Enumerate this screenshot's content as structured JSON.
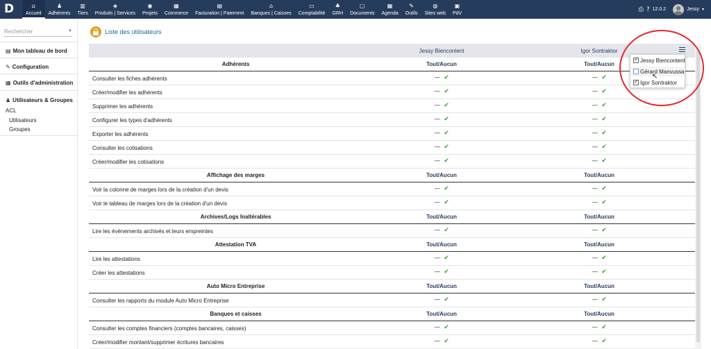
{
  "topbar": {
    "logo": "D",
    "menu": [
      {
        "icon": "⌂",
        "label": "Accueil",
        "active": true
      },
      {
        "icon": "♟",
        "label": "Adhérents"
      },
      {
        "icon": "▥",
        "label": "Tiers"
      },
      {
        "icon": "◈",
        "label": "Produits | Services"
      },
      {
        "icon": "◉",
        "label": "Projets"
      },
      {
        "icon": "▦",
        "label": "Commerce"
      },
      {
        "icon": "▤",
        "label": "Facturation | Paiement"
      },
      {
        "icon": "⌂",
        "label": "Banques | Caisses"
      },
      {
        "icon": "▭",
        "label": "Comptabilité"
      },
      {
        "icon": "♣",
        "label": "GRH"
      },
      {
        "icon": "▢",
        "label": "Documents"
      },
      {
        "icon": "▦",
        "label": "Agenda"
      },
      {
        "icon": "✎",
        "label": "Outils"
      },
      {
        "icon": "◍",
        "label": "Sites web"
      },
      {
        "icon": "▣",
        "label": "PdV"
      }
    ],
    "version": "12.0.2",
    "user": "Jessy",
    "print_icon": "⎙",
    "help_icon": "?"
  },
  "sidebar": {
    "search_placeholder": "Rechercher",
    "sections": [
      {
        "icon": "▤",
        "title": "Mon tableau de bord"
      },
      {
        "icon": "✎",
        "title": "Configuration"
      },
      {
        "icon": "▦",
        "title": "Outils d'administration"
      },
      {
        "icon": "♟",
        "title": "Utilisateurs & Groupes",
        "items": [
          "ACL",
          "Utilisateurs",
          "Groupes"
        ]
      }
    ]
  },
  "page": {
    "title": "Liste des utilisateurs"
  },
  "columns": [
    "Jessy Biencontent",
    "Igor Sontraktor"
  ],
  "toggle_label": "Tout/Aucun",
  "marks": {
    "dash": "—",
    "check": "✔"
  },
  "sections": [
    {
      "title": "Adhérents",
      "perms": [
        "Consulter les fiches adhérents",
        "Créer/modifier les adhérents",
        "Supprimer les adhérents",
        "Configurer les types d'adhérents",
        "Exporter les adhérents",
        "Consulter les cotisations",
        "Créer/modifier les cotisations"
      ]
    },
    {
      "title": "Affichage des marges",
      "perms": [
        "Voir la colonne de marges lors de la création d'un devis",
        "Voir le tableau de marges lors de la création d'un devis"
      ]
    },
    {
      "title": "Archives/Logs Inaltérables",
      "perms": [
        "Lire les événements archivés et leurs empreintes"
      ]
    },
    {
      "title": "Attestation TVA",
      "perms": [
        "Lire les attestations",
        "Créer les attestations"
      ]
    },
    {
      "title": "Auto Micro Entreprise",
      "perms": [
        "Consulter les rapports du module Auto Micro Entreprise"
      ]
    },
    {
      "title": "Banques et caisses",
      "perms": [
        "Consulter les comptes financiers (comptes bancaires, caisses)",
        "Créer/modifier montant/supprimer écritures bancaires"
      ]
    }
  ],
  "column_selector": {
    "items": [
      {
        "label": "Jessy Biencontent",
        "checked": true
      },
      {
        "label": "Gérard Manvussa",
        "checked": false
      },
      {
        "label": "Igor Sontraktor",
        "checked": true
      }
    ]
  },
  "colors": {
    "topbar": "#263c5c",
    "accent": "#263c5c",
    "check": "#3a9d32",
    "highlight_circle": "#e3262c"
  }
}
